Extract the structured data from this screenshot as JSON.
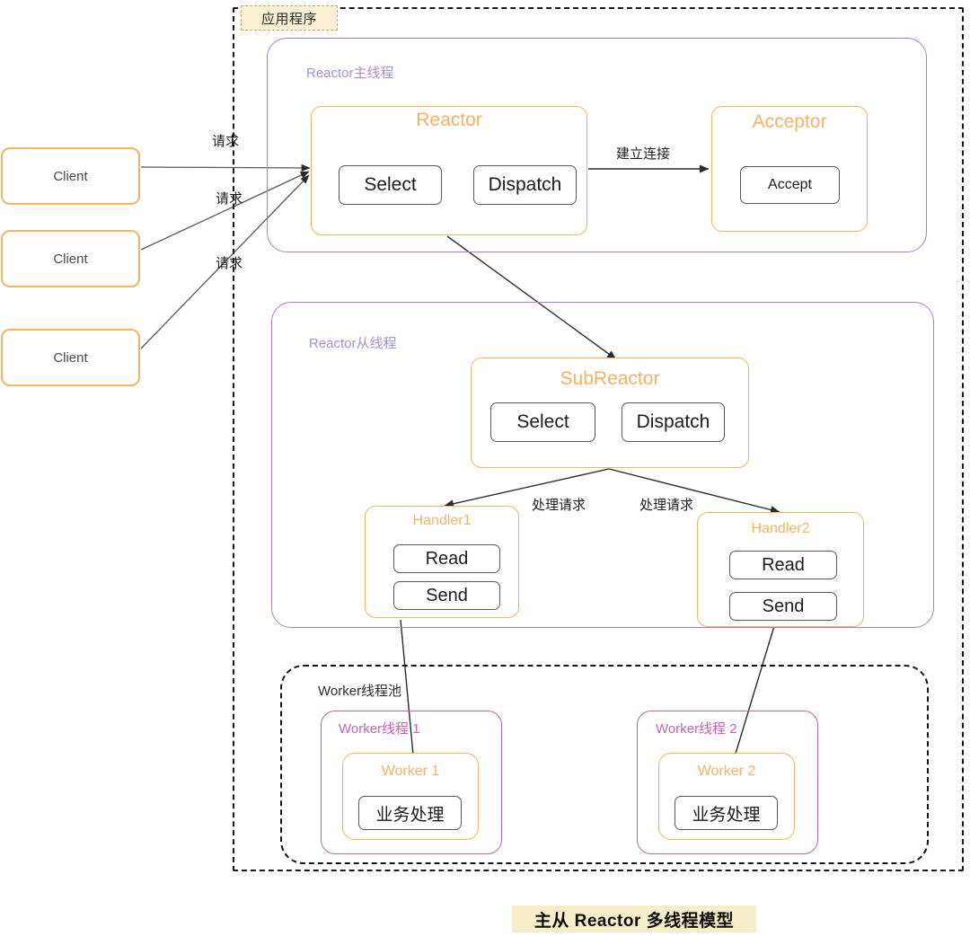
{
  "diagram": {
    "caption": "主从 Reactor 多线程模型",
    "app_container_label": "应用程序",
    "colors": {
      "orange": "#f5b263",
      "orange_text": "#f9b063",
      "purple": "#a980c4",
      "purple_text": "#a98fd0",
      "magenta": "#b4699f",
      "magenta_text": "#cb5fb4",
      "chip_border": "#59595b",
      "dashed": "#141414",
      "caption_highlight": "#f7edc8",
      "app_tag_bg": "#f8efd4"
    }
  },
  "clients": [
    {
      "label": "Client"
    },
    {
      "label": "Client"
    },
    {
      "label": "Client"
    }
  ],
  "main_thread": {
    "label": "Reactor主线程",
    "reactor": {
      "title": "Reactor",
      "chips": [
        "Select",
        "Dispatch"
      ]
    },
    "acceptor": {
      "title": "Acceptor",
      "chips": [
        "Accept"
      ]
    }
  },
  "sub_thread": {
    "label": "Reactor从线程",
    "subreactor": {
      "title": "SubReactor",
      "chips": [
        "Select",
        "Dispatch"
      ]
    },
    "handlers": [
      {
        "title": "Handler1",
        "chips": [
          "Read",
          "Send"
        ]
      },
      {
        "title": "Handler2",
        "chips": [
          "Read",
          "Send"
        ]
      }
    ]
  },
  "worker_pool": {
    "label": "Worker线程池",
    "threads": [
      {
        "label": "Worker线程 1",
        "worker_title": "Worker 1",
        "chip": "业务处理"
      },
      {
        "label": "Worker线程 2",
        "worker_title": "Worker 2",
        "chip": "业务处理"
      }
    ]
  },
  "edge_labels": {
    "request_1": "请求",
    "request_2": "请求",
    "request_3": "请求",
    "establish_connection": "建立连接",
    "handle_request_1": "处理请求",
    "handle_request_2": "处理请求"
  }
}
